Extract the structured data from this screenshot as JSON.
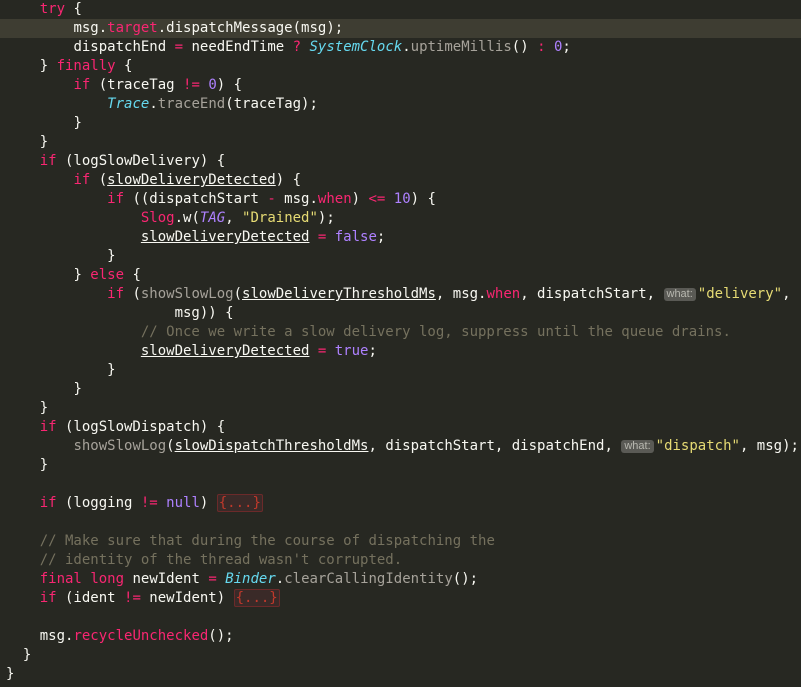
{
  "editor": {
    "lines": [
      {
        "indent": "    ",
        "tokens": [
          [
            "kw",
            "try"
          ],
          [
            "p",
            " {"
          ]
        ]
      },
      {
        "indent": "        ",
        "current": true,
        "tokens": [
          [
            "p",
            "msg."
          ],
          [
            "field",
            "target"
          ],
          [
            "p",
            "."
          ],
          [
            "fn",
            "dispatchMessage"
          ],
          [
            "p",
            "(msg);"
          ]
        ]
      },
      {
        "indent": "        ",
        "tokens": [
          [
            "p",
            "dispatchEnd "
          ],
          [
            "op",
            "="
          ],
          [
            "p",
            " needEndTime "
          ],
          [
            "op",
            "?"
          ],
          [
            "p",
            " "
          ],
          [
            "cls",
            "SystemClock"
          ],
          [
            "p",
            "."
          ],
          [
            "dim",
            "uptimeMillis"
          ],
          [
            "p",
            "() "
          ],
          [
            "op",
            ":"
          ],
          [
            "p",
            " "
          ],
          [
            "num",
            "0"
          ],
          [
            "p",
            ";"
          ]
        ]
      },
      {
        "indent": "    ",
        "tokens": [
          [
            "p",
            "} "
          ],
          [
            "kw",
            "finally"
          ],
          [
            "p",
            " {"
          ]
        ]
      },
      {
        "indent": "        ",
        "tokens": [
          [
            "kw",
            "if"
          ],
          [
            "p",
            " (traceTag "
          ],
          [
            "op",
            "!="
          ],
          [
            "p",
            " "
          ],
          [
            "num",
            "0"
          ],
          [
            "p",
            ") {"
          ]
        ]
      },
      {
        "indent": "            ",
        "tokens": [
          [
            "cls",
            "Trace"
          ],
          [
            "p",
            "."
          ],
          [
            "dim",
            "traceEnd"
          ],
          [
            "p",
            "(traceTag);"
          ]
        ]
      },
      {
        "indent": "        ",
        "tokens": [
          [
            "p",
            "}"
          ]
        ]
      },
      {
        "indent": "    ",
        "tokens": [
          [
            "p",
            "}"
          ]
        ]
      },
      {
        "indent": "    ",
        "tokens": [
          [
            "kw",
            "if"
          ],
          [
            "p",
            " (logSlowDelivery) {"
          ]
        ]
      },
      {
        "indent": "        ",
        "tokens": [
          [
            "kw",
            "if"
          ],
          [
            "p",
            " ("
          ],
          [
            "ul",
            "slowDeliveryDetected"
          ],
          [
            "p",
            ") {"
          ]
        ]
      },
      {
        "indent": "            ",
        "tokens": [
          [
            "kw",
            "if"
          ],
          [
            "p",
            " ((dispatchStart "
          ],
          [
            "op",
            "-"
          ],
          [
            "p",
            " msg."
          ],
          [
            "field",
            "when"
          ],
          [
            "p",
            ") "
          ],
          [
            "op",
            "<="
          ],
          [
            "p",
            " "
          ],
          [
            "num",
            "10"
          ],
          [
            "p",
            ") {"
          ]
        ]
      },
      {
        "indent": "                ",
        "tokens": [
          [
            "field",
            "Slog"
          ],
          [
            "p",
            "."
          ],
          [
            "fn",
            "w"
          ],
          [
            "p",
            "("
          ],
          [
            "purpleit",
            "TAG"
          ],
          [
            "p",
            ", "
          ],
          [
            "str",
            "\"Drained\""
          ],
          [
            "p",
            ");"
          ]
        ]
      },
      {
        "indent": "                ",
        "tokens": [
          [
            "ul",
            "slowDeliveryDetected"
          ],
          [
            "p",
            " "
          ],
          [
            "op",
            "="
          ],
          [
            "p",
            " "
          ],
          [
            "const",
            "false"
          ],
          [
            "p",
            ";"
          ]
        ]
      },
      {
        "indent": "            ",
        "tokens": [
          [
            "p",
            "}"
          ]
        ]
      },
      {
        "indent": "        ",
        "tokens": [
          [
            "p",
            "} "
          ],
          [
            "kw",
            "else"
          ],
          [
            "p",
            " {"
          ]
        ]
      },
      {
        "indent": "            ",
        "tokens": [
          [
            "kw",
            "if"
          ],
          [
            "p",
            " ("
          ],
          [
            "dim",
            "showSlowLog"
          ],
          [
            "p",
            "("
          ],
          [
            "ul",
            "slowDeliveryThresholdMs"
          ],
          [
            "p",
            ", msg."
          ],
          [
            "field",
            "when"
          ],
          [
            "p",
            ", dispatchStart, "
          ],
          [
            "hint",
            "what:"
          ],
          [
            "str",
            "\"delivery\""
          ],
          [
            "p",
            ","
          ]
        ]
      },
      {
        "indent": "                    ",
        "tokens": [
          [
            "p",
            "msg)) {"
          ]
        ]
      },
      {
        "indent": "                ",
        "tokens": [
          [
            "cmt",
            "// Once we write a slow delivery log, suppress until the queue drains."
          ]
        ]
      },
      {
        "indent": "                ",
        "tokens": [
          [
            "ul",
            "slowDeliveryDetected"
          ],
          [
            "p",
            " "
          ],
          [
            "op",
            "="
          ],
          [
            "p",
            " "
          ],
          [
            "const",
            "true"
          ],
          [
            "p",
            ";"
          ]
        ]
      },
      {
        "indent": "            ",
        "tokens": [
          [
            "p",
            "}"
          ]
        ]
      },
      {
        "indent": "        ",
        "tokens": [
          [
            "p",
            "}"
          ]
        ]
      },
      {
        "indent": "    ",
        "tokens": [
          [
            "p",
            "}"
          ]
        ]
      },
      {
        "indent": "    ",
        "tokens": [
          [
            "kw",
            "if"
          ],
          [
            "p",
            " (logSlowDispatch) {"
          ]
        ]
      },
      {
        "indent": "        ",
        "tokens": [
          [
            "dim",
            "showSlowLog"
          ],
          [
            "p",
            "("
          ],
          [
            "ul",
            "slowDispatchThresholdMs"
          ],
          [
            "p",
            ", dispatchStart, dispatchEnd, "
          ],
          [
            "hint",
            "what:"
          ],
          [
            "str",
            "\"dispatch\""
          ],
          [
            "p",
            ", msg);"
          ]
        ]
      },
      {
        "indent": "    ",
        "tokens": [
          [
            "p",
            "}"
          ]
        ]
      },
      {
        "indent": "",
        "tokens": []
      },
      {
        "indent": "    ",
        "tokens": [
          [
            "kw",
            "if"
          ],
          [
            "p",
            " (logging "
          ],
          [
            "op",
            "!="
          ],
          [
            "p",
            " "
          ],
          [
            "const",
            "null"
          ],
          [
            "p",
            ") "
          ],
          [
            "fold",
            "{...}"
          ]
        ]
      },
      {
        "indent": "",
        "tokens": []
      },
      {
        "indent": "    ",
        "tokens": [
          [
            "cmt",
            "// Make sure that during the course of dispatching the"
          ]
        ]
      },
      {
        "indent": "    ",
        "tokens": [
          [
            "cmt",
            "// identity of the thread wasn't corrupted."
          ]
        ]
      },
      {
        "indent": "    ",
        "tokens": [
          [
            "kw",
            "final"
          ],
          [
            "p",
            " "
          ],
          [
            "kw",
            "long"
          ],
          [
            "p",
            " newIdent "
          ],
          [
            "op",
            "="
          ],
          [
            "p",
            " "
          ],
          [
            "cls",
            "Binder"
          ],
          [
            "p",
            "."
          ],
          [
            "dim",
            "clearCallingIdentity"
          ],
          [
            "p",
            "();"
          ]
        ]
      },
      {
        "indent": "    ",
        "tokens": [
          [
            "kw",
            "if"
          ],
          [
            "p",
            " (ident "
          ],
          [
            "op",
            "!="
          ],
          [
            "p",
            " newIdent) "
          ],
          [
            "fold",
            "{...}"
          ]
        ]
      },
      {
        "indent": "",
        "tokens": []
      },
      {
        "indent": "    ",
        "tokens": [
          [
            "p",
            "msg."
          ],
          [
            "field",
            "recycleUnchecked"
          ],
          [
            "p",
            "();"
          ]
        ]
      },
      {
        "indent": "  ",
        "tokens": [
          [
            "p",
            "}"
          ]
        ]
      },
      {
        "indent": "",
        "tokens": [
          [
            "p",
            "}"
          ]
        ]
      }
    ],
    "line_tops": [
      0,
      19,
      38,
      57,
      76,
      95,
      114,
      133,
      152,
      171,
      190,
      209,
      228,
      247,
      266,
      285,
      304,
      323,
      342,
      361,
      380,
      399,
      418,
      437,
      456,
      475,
      494,
      513,
      532,
      551,
      570,
      589,
      608,
      627,
      646,
      665
    ]
  }
}
